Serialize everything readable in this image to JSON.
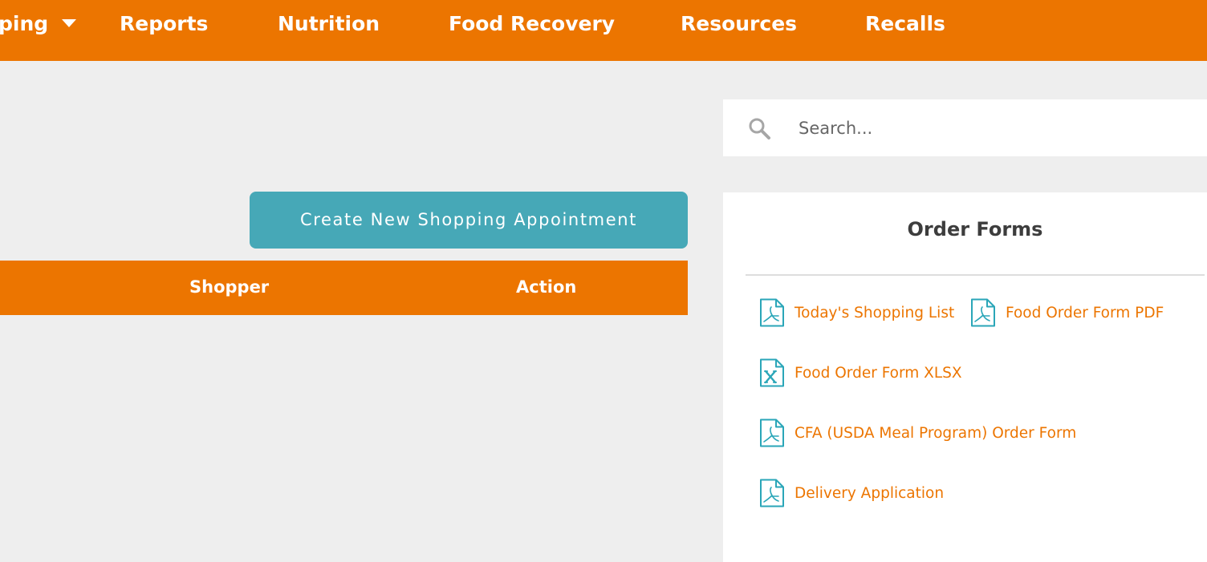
{
  "nav": {
    "items": [
      "ping",
      "Reports",
      "Nutrition",
      "Food Recovery",
      "Resources",
      "Recalls"
    ]
  },
  "search": {
    "placeholder": "Search..."
  },
  "main": {
    "create_button": "Create New Shopping Appointment",
    "table": {
      "columns": [
        "Shopper",
        "Action"
      ]
    }
  },
  "sidebar": {
    "title": "Order Forms",
    "links": [
      {
        "label": "Today's Shopping List",
        "icon": "pdf-file-icon"
      },
      {
        "label": "Food Order Form PDF",
        "icon": "pdf-file-icon"
      },
      {
        "label": "Food Order Form XLSX",
        "icon": "xlsx-file-icon"
      },
      {
        "label": "CFA (USDA Meal Program) Order Form",
        "icon": "pdf-file-icon"
      },
      {
        "label": "Delivery Application",
        "icon": "pdf-file-icon"
      }
    ]
  },
  "colors": {
    "brand_orange": "#ec7500",
    "button_teal": "#46a8b7",
    "icon_teal": "#2aa6b8",
    "page_bg": "#eeeeee"
  }
}
